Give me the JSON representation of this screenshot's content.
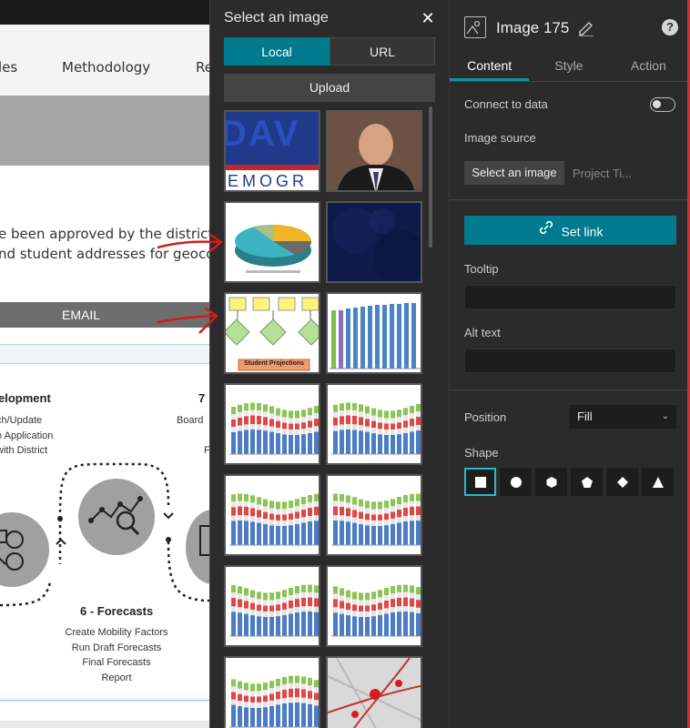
{
  "page": {
    "nav": [
      "les",
      "Methodology",
      "Re"
    ],
    "body_lines": [
      "e been approved by the district, w",
      "nd student addresses for geocod"
    ],
    "email_label": "EMAIL",
    "section_left_heading": "elopment",
    "section_right_heading": "7",
    "left_list": [
      "ch/Update",
      "o Application",
      "with District"
    ],
    "right_list": [
      "Board",
      "F"
    ],
    "forecast_heading": "6 - Forecasts",
    "forecast_items": [
      "Create Mobility Factors",
      "Run Draft Forecasts",
      "Final Forecasts",
      "Report"
    ]
  },
  "picker": {
    "title": "Select an image",
    "close_icon": "close-icon",
    "tabs": [
      {
        "label": "Local",
        "active": true
      },
      {
        "label": "URL",
        "active": false
      }
    ],
    "upload_label": "Upload",
    "thumbs": [
      {
        "name": "thumb-dav-logo",
        "logo_line1": "DAV",
        "logo_line2": "EMOGR"
      },
      {
        "name": "thumb-portrait"
      },
      {
        "name": "thumb-pie-chart"
      },
      {
        "name": "thumb-blue-texture"
      },
      {
        "name": "thumb-flowchart",
        "caption": "Student Projections"
      },
      {
        "name": "thumb-bar-chart"
      },
      {
        "name": "thumb-stacked-chart-1"
      },
      {
        "name": "thumb-stacked-chart-2"
      },
      {
        "name": "thumb-stacked-chart-3"
      },
      {
        "name": "thumb-stacked-chart-4"
      },
      {
        "name": "thumb-stacked-chart-5"
      },
      {
        "name": "thumb-stacked-chart-6"
      },
      {
        "name": "thumb-stacked-chart-7"
      },
      {
        "name": "thumb-map"
      }
    ]
  },
  "panel": {
    "title": "Image 175",
    "tabs": [
      {
        "label": "Content",
        "active": true
      },
      {
        "label": "Style",
        "active": false
      },
      {
        "label": "Action",
        "active": false
      }
    ],
    "connect_label": "Connect to data",
    "connect_on": false,
    "image_source_label": "Image source",
    "select_image_label": "Select an image",
    "project_label": "Project Ti...",
    "set_link_label": "Set link",
    "tooltip_label": "Tooltip",
    "alt_text_label": "Alt text",
    "position_label": "Position",
    "position_value": "Fill",
    "shape_label": "Shape",
    "shapes": [
      "square",
      "circle",
      "hexagon",
      "pentagon",
      "diamond",
      "triangle"
    ],
    "active_shape": "square"
  },
  "colors": {
    "accent": "#007a8f",
    "panel_bg": "#2b2b2b",
    "annotation_red": "#d61a1a",
    "shape_active": "#2ab7d0"
  }
}
